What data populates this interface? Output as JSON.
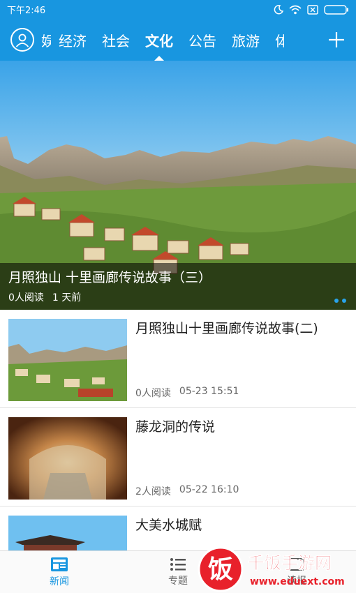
{
  "status_bar": {
    "time": "下午2:46",
    "icons": [
      "moon-icon",
      "wifi-icon",
      "sim-off-icon",
      "battery-icon"
    ]
  },
  "navbar": {
    "tabs": [
      {
        "label": "娱",
        "partial": true
      },
      {
        "label": "经济"
      },
      {
        "label": "社会"
      },
      {
        "label": "文化",
        "active": true
      },
      {
        "label": "公告"
      },
      {
        "label": "旅游"
      },
      {
        "label": "体",
        "partial": true
      }
    ],
    "colors": {
      "primary": "#1896e0"
    }
  },
  "hero": {
    "title": "月照独山 十里画廊传说故事（三）",
    "reads": "0人阅读",
    "time": "1 天前",
    "page_indicator": {
      "count": 2,
      "active": 1
    }
  },
  "articles": [
    {
      "title": "月照独山十里画廊传说故事(二)",
      "reads": "0人阅读",
      "time": "05-23 15:51",
      "thumb": "mountain-village"
    },
    {
      "title": "藤龙洞的传说",
      "reads": "2人阅读",
      "time": "05-22 16:10",
      "thumb": "cave"
    },
    {
      "title": "大美水城赋",
      "reads": "",
      "time": "",
      "thumb": "pavilion"
    }
  ],
  "bottom_nav": [
    {
      "label": "新闻",
      "icon": "newspaper-icon",
      "active": true
    },
    {
      "label": "专题",
      "icon": "list-icon"
    },
    {
      "label": "读报",
      "icon": "newspaper-read-icon"
    }
  ],
  "watermark": {
    "brand": "饭",
    "name": "千饭手游网",
    "url": "www.eduext.com"
  }
}
